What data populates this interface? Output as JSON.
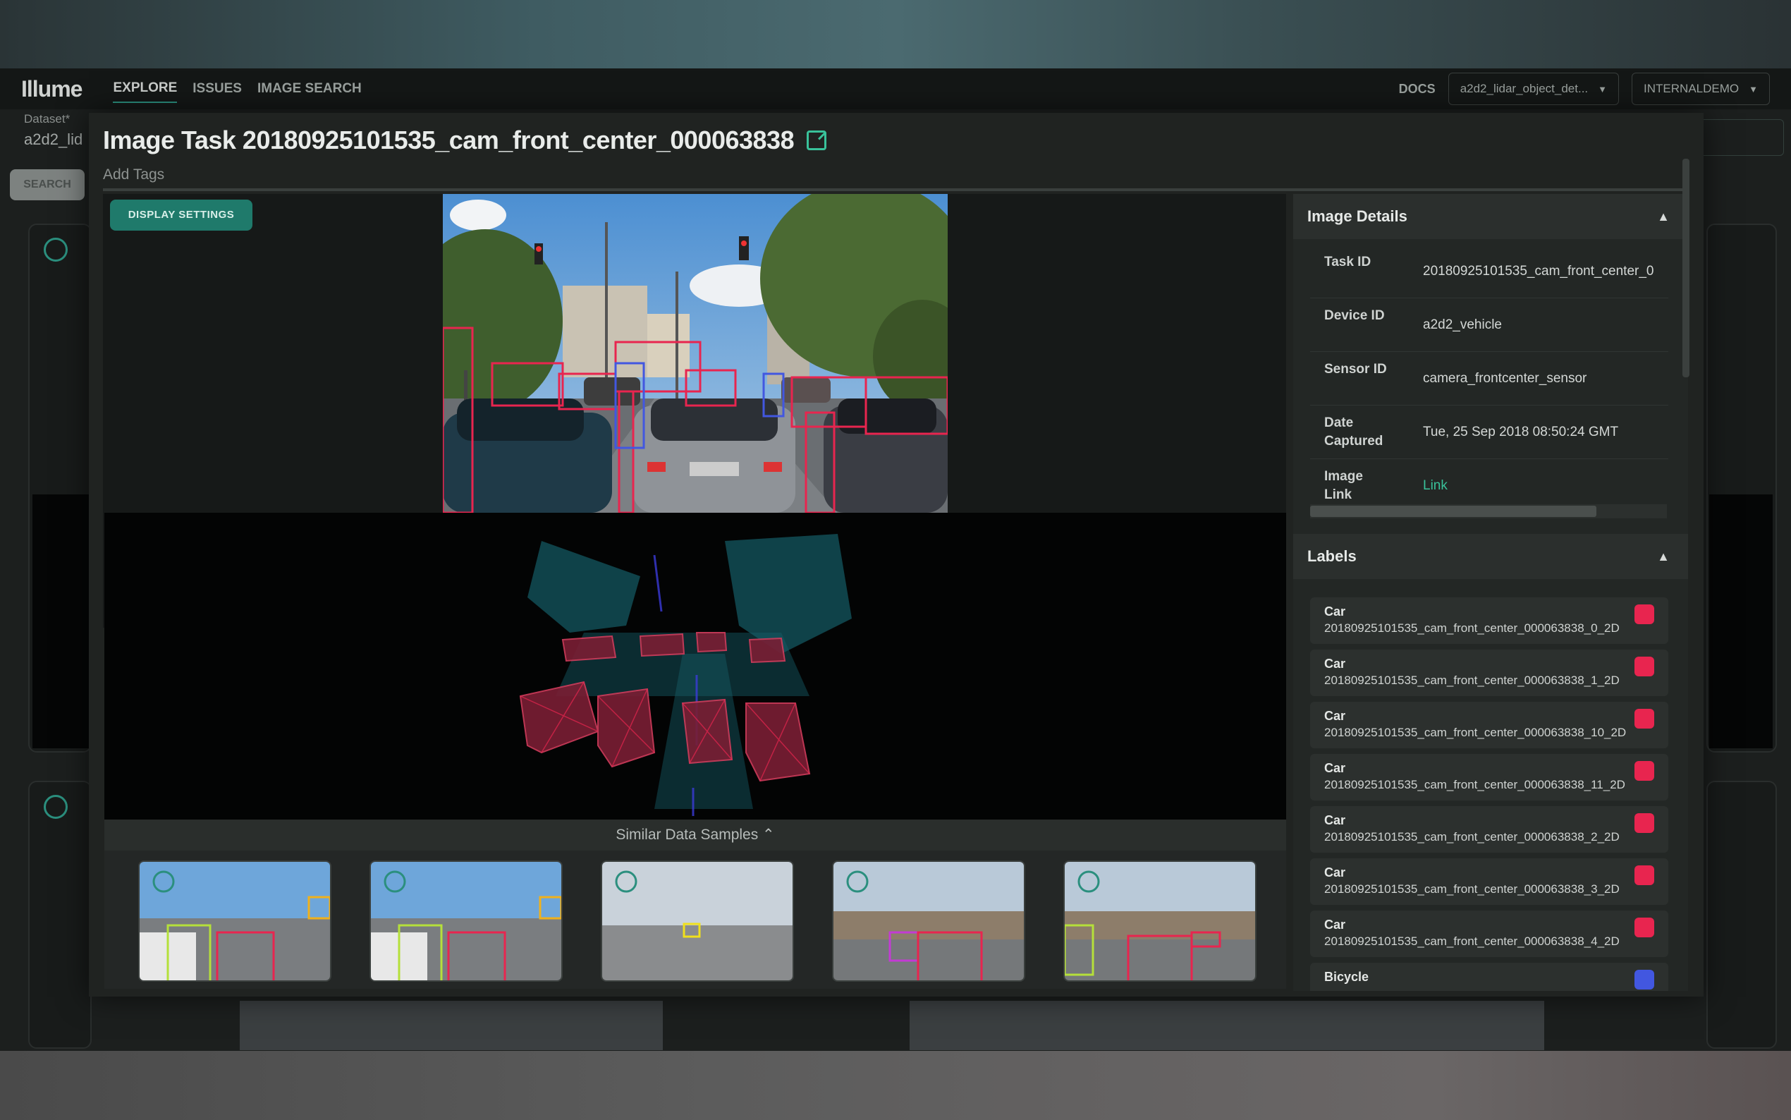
{
  "nav": {
    "brand": "Illume",
    "tabs": [
      "EXPLORE",
      "ISSUES",
      "IMAGE SEARCH"
    ],
    "docs": "DOCS",
    "dataset_select": "a2d2_lidar_object_det...",
    "org_select": "INTERNALDEMO"
  },
  "background": {
    "dataset_label": "Dataset*",
    "dataset_value": "a2d2_lid",
    "search_button": "SEARCH"
  },
  "modal": {
    "title": "Image Task 20180925101535_cam_front_center_000063838",
    "add_tags": "Add Tags",
    "display_settings": "DISPLAY SETTINGS",
    "similar_title": "Similar Data Samples ⌃"
  },
  "image_details": {
    "header": "Image Details",
    "rows": [
      {
        "key": "Task ID",
        "value": "20180925101535_cam_front_center_0"
      },
      {
        "key": "Device ID",
        "value": "a2d2_vehicle"
      },
      {
        "key": "Sensor ID",
        "value": "camera_frontcenter_sensor"
      },
      {
        "key": "Date Captured",
        "value": "Tue, 25 Sep 2018 08:50:24 GMT"
      },
      {
        "key": "Image Link",
        "value": "Link"
      }
    ]
  },
  "labels": {
    "header": "Labels",
    "items": [
      {
        "cls": "Car",
        "id": "20180925101535_cam_front_center_000063838_0_2D",
        "color": "#e8254f"
      },
      {
        "cls": "Car",
        "id": "20180925101535_cam_front_center_000063838_1_2D",
        "color": "#e8254f"
      },
      {
        "cls": "Car",
        "id": "20180925101535_cam_front_center_000063838_10_2D",
        "color": "#e8254f"
      },
      {
        "cls": "Car",
        "id": "20180925101535_cam_front_center_000063838_11_2D",
        "color": "#e8254f"
      },
      {
        "cls": "Car",
        "id": "20180925101535_cam_front_center_000063838_2_2D",
        "color": "#e8254f"
      },
      {
        "cls": "Car",
        "id": "20180925101535_cam_front_center_000063838_3_2D",
        "color": "#e8254f"
      },
      {
        "cls": "Car",
        "id": "20180925101535_cam_front_center_000063838_4_2D",
        "color": "#e8254f"
      },
      {
        "cls": "Bicycle",
        "id": "",
        "color": "#4257e0"
      }
    ]
  },
  "colors": {
    "accent": "#2b8f7e",
    "link": "#39c29a",
    "car_box": "#e8254f",
    "bicycle_box": "#4257e0"
  }
}
